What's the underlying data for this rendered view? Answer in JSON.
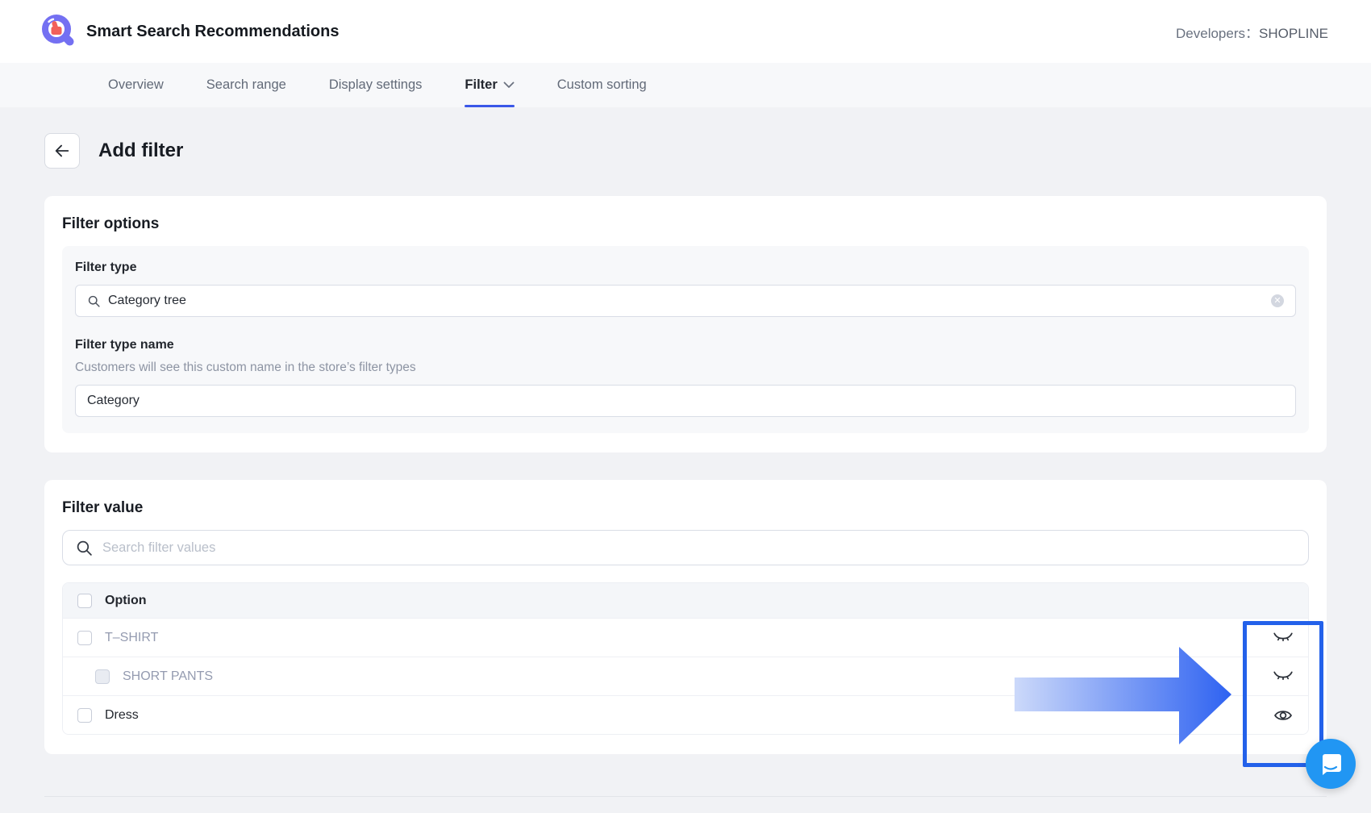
{
  "header": {
    "app_title": "Smart Search Recommendations",
    "developers_label": "Developers：",
    "developers_value": "SHOPLINE"
  },
  "tabs": [
    {
      "label": "Overview",
      "active": false,
      "has_dropdown": false
    },
    {
      "label": "Search range",
      "active": false,
      "has_dropdown": false
    },
    {
      "label": "Display settings",
      "active": false,
      "has_dropdown": false
    },
    {
      "label": "Filter",
      "active": true,
      "has_dropdown": true
    },
    {
      "label": "Custom sorting",
      "active": false,
      "has_dropdown": false
    }
  ],
  "page": {
    "title": "Add filter"
  },
  "filter_options": {
    "title": "Filter options",
    "filter_type_label": "Filter type",
    "filter_type_value": "Category tree",
    "filter_type_name_label": "Filter type name",
    "filter_type_name_help": "Customers will see this custom name in the store’s filter types",
    "filter_type_name_value": "Category"
  },
  "filter_value": {
    "title": "Filter value",
    "search_placeholder": "Search filter values",
    "table": {
      "header": "Option",
      "rows": [
        {
          "label": "T–SHIRT",
          "indent": false,
          "muted": true,
          "checkbox_disabled": false,
          "eye": "eye-closed"
        },
        {
          "label": "SHORT PANTS",
          "indent": true,
          "muted": true,
          "checkbox_disabled": true,
          "eye": "eye-closed"
        },
        {
          "label": "Dress",
          "indent": false,
          "muted": false,
          "checkbox_disabled": false,
          "eye": "eye-open"
        }
      ]
    }
  },
  "icons": {
    "logo": "magnifier-thumbs-up-icon",
    "back": "arrow-left-icon",
    "tab_dropdown": "chevron-down-icon",
    "input_search": "search-icon",
    "input_clear": "clear-icon",
    "row_hidden": "eye-closed-icon",
    "row_visible": "eye-open-icon",
    "chat": "chat-bubble-icon"
  },
  "colors": {
    "accent_underline": "#3a57e8",
    "highlight_box": "#2361ea",
    "arrow_gradient_start": "#ccd9fa",
    "arrow_gradient_end": "#2e62f1",
    "chat_launcher": "#2196f3",
    "logo_purple": "#7470f2",
    "logo_thumb": "#f2605a",
    "muted_row_text": "#949bb0"
  }
}
